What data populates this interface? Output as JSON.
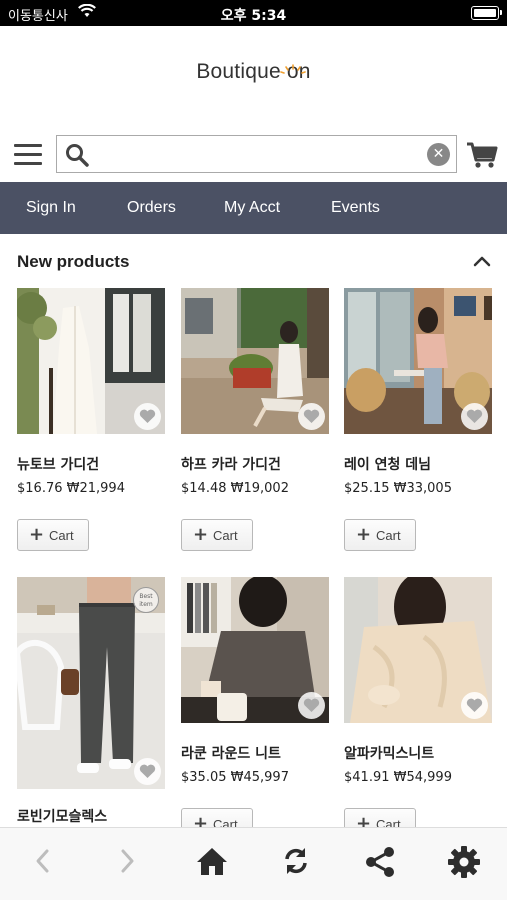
{
  "status_bar": {
    "carrier": "이동통신사",
    "time": "오후 5:34"
  },
  "brand": {
    "name": "Boutique on"
  },
  "search": {
    "value": "",
    "placeholder": ""
  },
  "nav": {
    "items": [
      {
        "label": "Sign In"
      },
      {
        "label": "Orders"
      },
      {
        "label": "My Acct"
      },
      {
        "label": "Events"
      }
    ]
  },
  "section": {
    "title": "New products"
  },
  "products": [
    {
      "name": "뉴토브 가디건",
      "price": "$16.76 ₩21,994",
      "cart_label": "Cart",
      "badge": ""
    },
    {
      "name": "하프 카라 가디건",
      "price": "$14.48 ₩19,002",
      "cart_label": "Cart",
      "badge": ""
    },
    {
      "name": "레이 연청 데님",
      "price": "$25.15 ₩33,005",
      "cart_label": "Cart",
      "badge": ""
    },
    {
      "name": "로빈기모슬렉스",
      "price": "",
      "cart_label": "",
      "badge": "Best item"
    },
    {
      "name": "라쿤 라운드 니트",
      "price": "$35.05 ₩45,997",
      "cart_label": "Cart",
      "badge": ""
    },
    {
      "name": "알파카믹스니트",
      "price": "$41.91 ₩54,999",
      "cart_label": "Cart",
      "badge": ""
    }
  ],
  "bottom_bar": {
    "icons": [
      "chevron-left-icon",
      "chevron-right-icon",
      "home-icon",
      "refresh-icon",
      "share-icon",
      "gear-icon"
    ]
  },
  "colors": {
    "nav_bg": "#4b5164",
    "status_bg": "#000000",
    "bottom_icons": "#2d2d2d"
  }
}
